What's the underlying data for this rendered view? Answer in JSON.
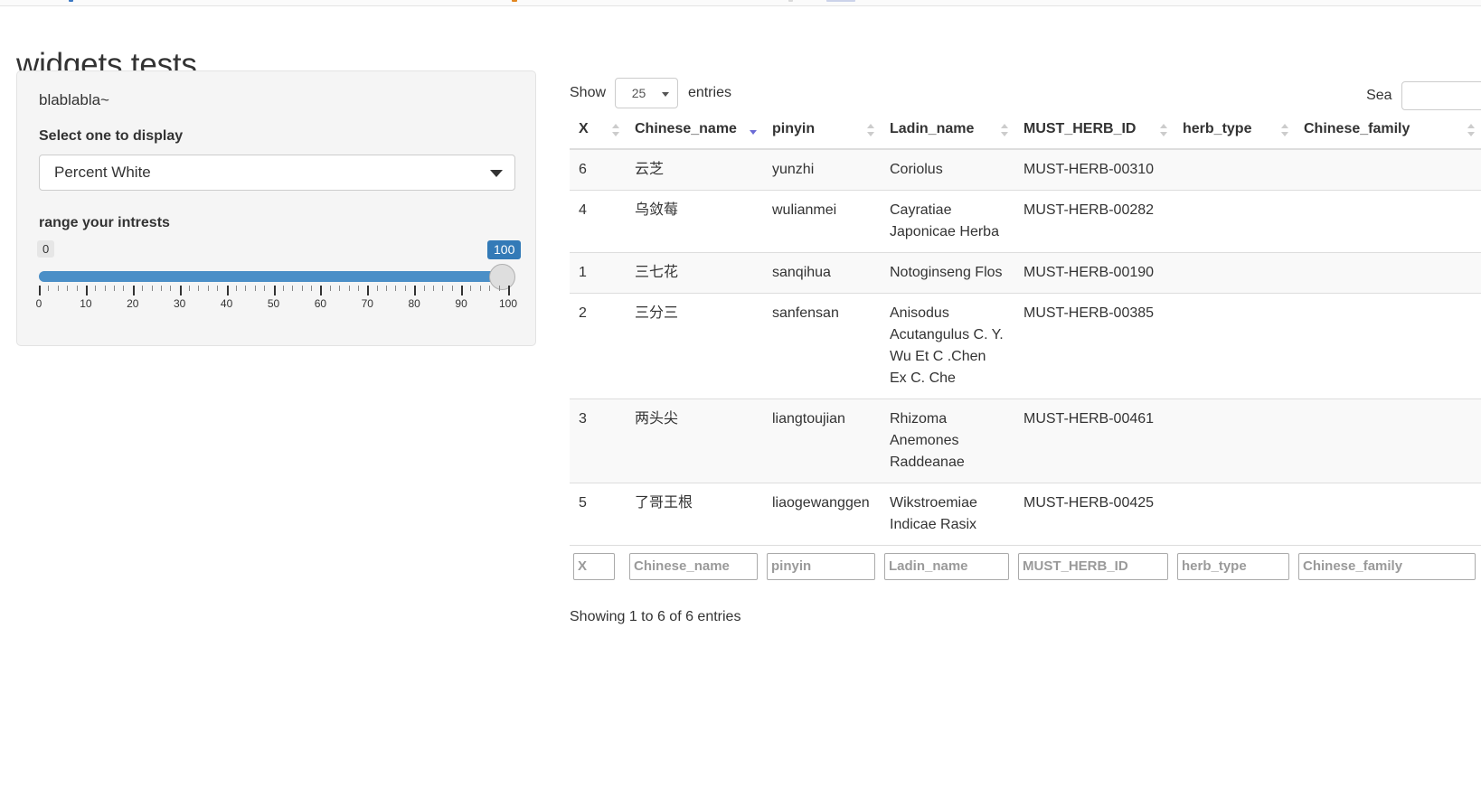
{
  "page": {
    "title": "widgets tests"
  },
  "panel": {
    "intro": "blablabla~",
    "select_label": "Select one to display",
    "select_value": "Percent White",
    "slider_label": "range your intrests",
    "slider_min_label": "0",
    "slider_max_label": "100",
    "slider_min": 0,
    "slider_max": 100,
    "slider_value": 100,
    "tick_labels": [
      "0",
      "10",
      "20",
      "30",
      "40",
      "50",
      "60",
      "70",
      "80",
      "90",
      "100"
    ]
  },
  "table_controls": {
    "show_label": "Show",
    "entries_label": "entries",
    "page_length": "25",
    "search_label": "Sea"
  },
  "table": {
    "columns": [
      {
        "key": "X",
        "label": "X",
        "sorted": "none"
      },
      {
        "key": "Chinese_name",
        "label": "Chinese_name",
        "sorted": "asc"
      },
      {
        "key": "pinyin",
        "label": "pinyin",
        "sorted": "none"
      },
      {
        "key": "Ladin_name",
        "label": "Ladin_name",
        "sorted": "none"
      },
      {
        "key": "MUST_HERB_ID",
        "label": "MUST_HERB_ID",
        "sorted": "none"
      },
      {
        "key": "herb_type",
        "label": "herb_type",
        "sorted": "none"
      },
      {
        "key": "Chinese_family",
        "label": "Chinese_family",
        "sorted": "none"
      }
    ],
    "rows": [
      {
        "X": "6",
        "Chinese_name": "云芝",
        "pinyin": "yunzhi",
        "Ladin_name": "Coriolus",
        "MUST_HERB_ID": "MUST-HERB-00310",
        "herb_type": "",
        "Chinese_family": ""
      },
      {
        "X": "4",
        "Chinese_name": "乌敛莓",
        "pinyin": "wulianmei",
        "Ladin_name": "Cayratiae Japonicae Herba",
        "MUST_HERB_ID": "MUST-HERB-00282",
        "herb_type": "",
        "Chinese_family": ""
      },
      {
        "X": "1",
        "Chinese_name": "三七花",
        "pinyin": "sanqihua",
        "Ladin_name": "Notoginseng Flos",
        "MUST_HERB_ID": "MUST-HERB-00190",
        "herb_type": "",
        "Chinese_family": ""
      },
      {
        "X": "2",
        "Chinese_name": "三分三",
        "pinyin": "sanfensan",
        "Ladin_name": "Anisodus Acutangulus C. Y. Wu Et C .Chen Ex C. Che",
        "MUST_HERB_ID": "MUST-HERB-00385",
        "herb_type": "",
        "Chinese_family": ""
      },
      {
        "X": "3",
        "Chinese_name": "两头尖",
        "pinyin": "liangtoujian",
        "Ladin_name": "Rhizoma Anemones Raddeanae",
        "MUST_HERB_ID": "MUST-HERB-00461",
        "herb_type": "",
        "Chinese_family": ""
      },
      {
        "X": "5",
        "Chinese_name": "了哥王根",
        "pinyin": "liaogewanggen",
        "Ladin_name": "Wikstroemiae Indicae Rasix",
        "MUST_HERB_ID": "MUST-HERB-00425",
        "herb_type": "",
        "Chinese_family": ""
      }
    ],
    "footer_filters": [
      "X",
      "Chinese_name",
      "pinyin",
      "Ladin_name",
      "MUST_HERB_ID",
      "herb_type",
      "Chinese_family"
    ],
    "info": "Showing 1 to 6 of 6 entries"
  },
  "colors": {
    "accent": "#337ab7",
    "slider_fill": "#4b8fc7",
    "sort_active": "#6b6bd6",
    "panel_bg": "#f5f5f5",
    "stripe": "#f9f9f9"
  }
}
